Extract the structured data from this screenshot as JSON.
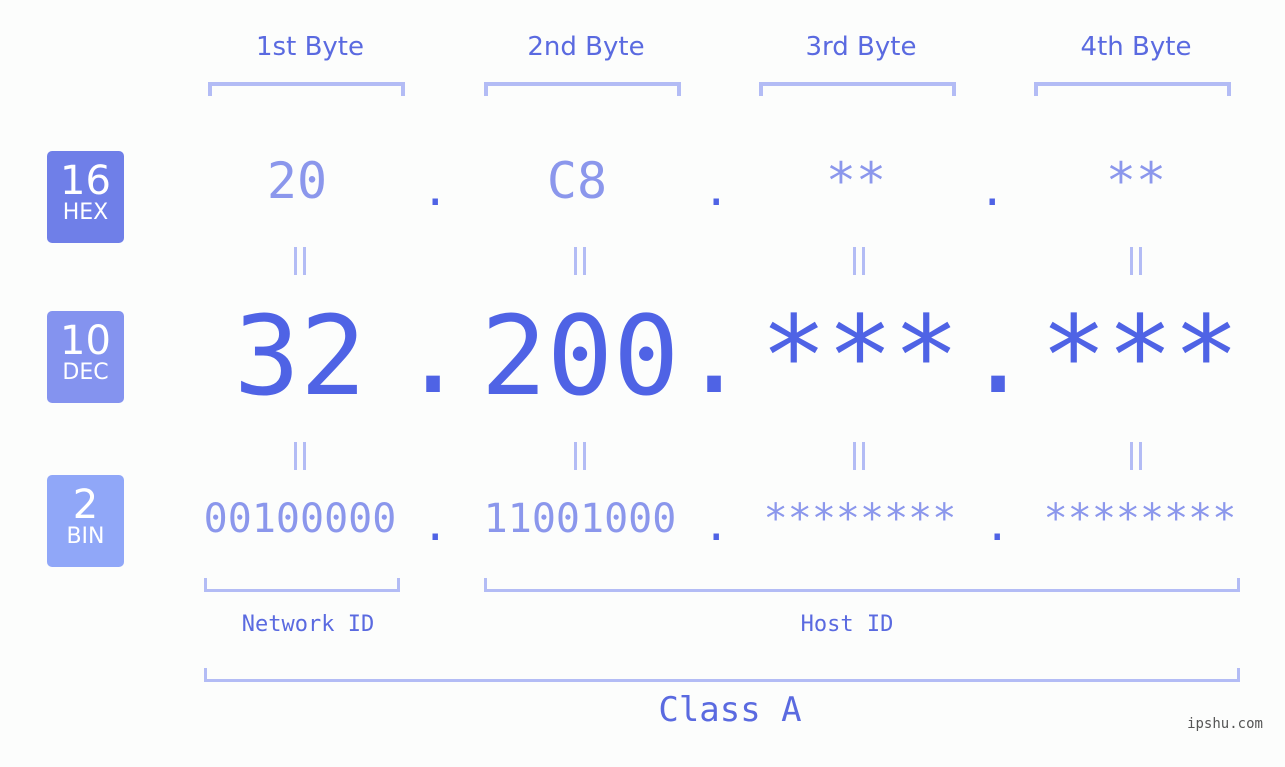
{
  "bytes": [
    {
      "label": "1st Byte",
      "hex": "20",
      "dec": "32",
      "bin": "00100000"
    },
    {
      "label": "2nd Byte",
      "hex": "C8",
      "dec": "200",
      "bin": "11001000"
    },
    {
      "label": "3rd Byte",
      "hex": "**",
      "dec": "***",
      "bin": "********"
    },
    {
      "label": "4th Byte",
      "hex": "**",
      "dec": "***",
      "bin": "********"
    }
  ],
  "separator": ".",
  "badges": {
    "hex": {
      "num": "16",
      "label": "HEX",
      "color": "#6f7fe8"
    },
    "dec": {
      "num": "10",
      "label": "DEC",
      "color": "#8493ef"
    },
    "bin": {
      "num": "2",
      "label": "BIN",
      "color": "#90a7f8"
    }
  },
  "network_id_label": "Network ID",
  "host_id_label": "Host ID",
  "class_label": "Class A",
  "watermark": "ipshu.com",
  "colors": {
    "primary": "#4f63e5",
    "light": "#8b97ec",
    "bracket": "#b3bcf5"
  }
}
